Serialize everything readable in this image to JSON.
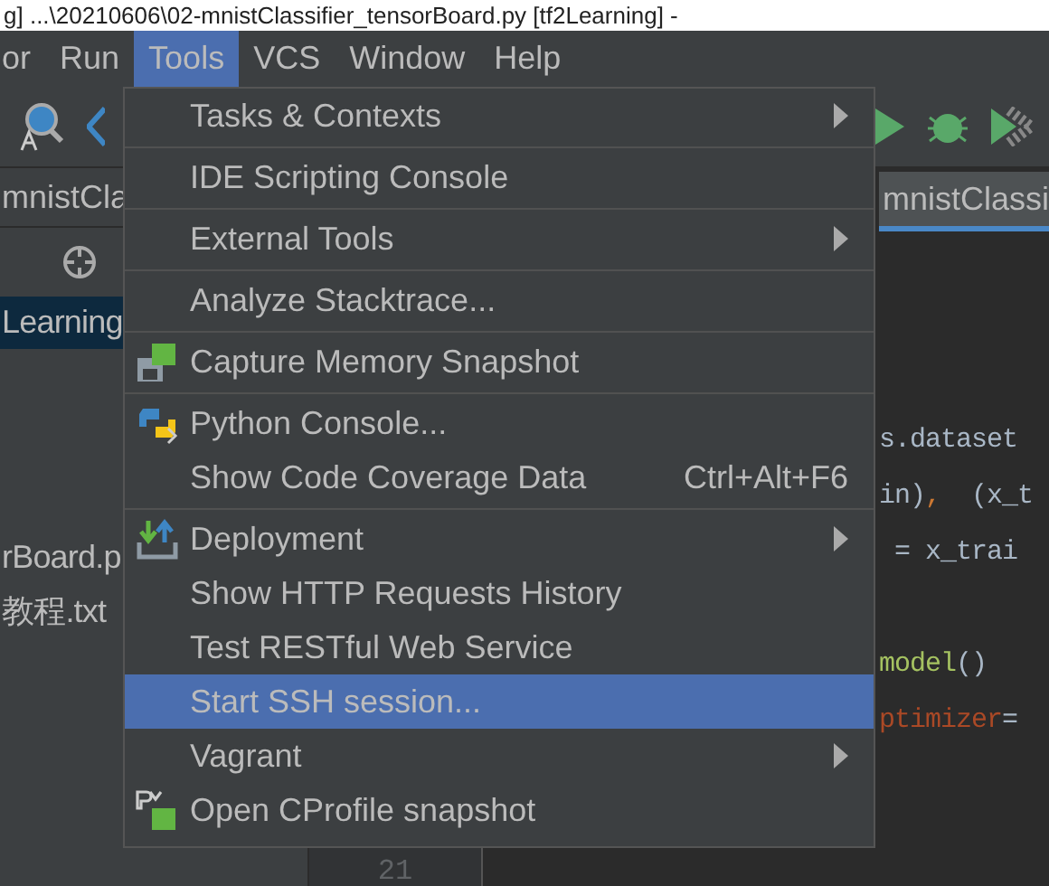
{
  "title_bar": {
    "text": "g]   ...\\20210606\\02-mnistClassifier_tensorBoard.py [tf2Learning] - "
  },
  "menu_bar": [
    {
      "label": "or",
      "selected": false
    },
    {
      "label": "Run",
      "selected": false
    },
    {
      "label": "Tools",
      "selected": true
    },
    {
      "label": "VCS",
      "selected": false
    },
    {
      "label": "Window",
      "selected": false
    },
    {
      "label": "Help",
      "selected": false
    }
  ],
  "project_panel": {
    "tab": "mnistCla",
    "rows": [
      {
        "label": "Learning",
        "selected": true
      },
      {
        "label": "rBoard.p",
        "selected": false
      },
      {
        "label": "教程.txt",
        "selected": false
      }
    ]
  },
  "editor": {
    "tab": "mnistClassi",
    "line_number": "21",
    "lines": [
      {
        "segments": [
          {
            "text": "s.dataset",
            "kind": "plain"
          }
        ]
      },
      {
        "segments": [
          {
            "text": "in)",
            "kind": "plain"
          },
          {
            "text": ",",
            "kind": "keyword"
          },
          {
            "text": "  (x_t",
            "kind": "plain"
          }
        ]
      },
      {
        "segments": [
          {
            "text": " = x_trai",
            "kind": "plain"
          }
        ]
      },
      {
        "segments": [
          {
            "text": "model",
            "kind": "call"
          },
          {
            "text": "()",
            "kind": "plain"
          }
        ]
      },
      {
        "segments": [
          {
            "text": "ptimizer",
            "kind": "param"
          },
          {
            "text": "=",
            "kind": "plain"
          }
        ]
      }
    ]
  },
  "tools_menu": [
    {
      "kind": "item",
      "label": "Tasks & Contexts",
      "submenu": true,
      "selected": false
    },
    {
      "kind": "separator"
    },
    {
      "kind": "item",
      "label": "IDE Scripting Console",
      "submenu": false,
      "selected": false
    },
    {
      "kind": "separator"
    },
    {
      "kind": "item",
      "label": "External Tools",
      "submenu": true,
      "selected": false
    },
    {
      "kind": "separator"
    },
    {
      "kind": "item",
      "label": "Analyze Stacktrace...",
      "submenu": false,
      "selected": false
    },
    {
      "kind": "separator"
    },
    {
      "kind": "item",
      "label": "Capture Memory Snapshot",
      "submenu": false,
      "selected": false
    },
    {
      "kind": "separator"
    },
    {
      "kind": "item",
      "label": "Python Console...",
      "submenu": false,
      "selected": false
    },
    {
      "kind": "item",
      "label": "Show Code Coverage Data",
      "shortcut": "Ctrl+Alt+F6",
      "submenu": false,
      "selected": false
    },
    {
      "kind": "separator"
    },
    {
      "kind": "item",
      "label": "Deployment",
      "submenu": true,
      "selected": false
    },
    {
      "kind": "item",
      "label": "Show HTTP Requests History",
      "submenu": false,
      "selected": false
    },
    {
      "kind": "item",
      "label": "Test RESTful Web Service",
      "submenu": false,
      "selected": false
    },
    {
      "kind": "item",
      "label": "Start SSH session...",
      "submenu": false,
      "selected": true
    },
    {
      "kind": "item",
      "label": "Vagrant",
      "submenu": true,
      "selected": false
    },
    {
      "kind": "item",
      "label": "Open CProfile snapshot",
      "submenu": false,
      "selected": false
    }
  ]
}
